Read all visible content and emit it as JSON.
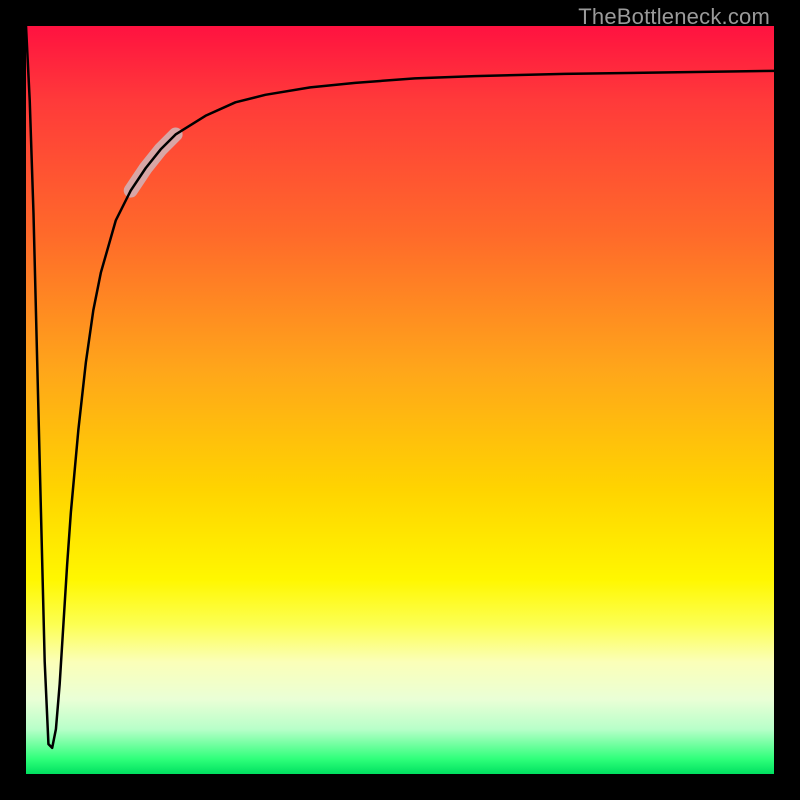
{
  "attribution": "TheBottleneck.com",
  "chart_data": {
    "type": "line",
    "title": "",
    "xlabel": "",
    "ylabel": "",
    "xlim": [
      0,
      100
    ],
    "ylim": [
      0,
      100
    ],
    "grid": false,
    "legend": null,
    "background_gradient_stops": [
      {
        "pos": 0,
        "color": "#ff1240"
      },
      {
        "pos": 10,
        "color": "#ff3a3a"
      },
      {
        "pos": 28,
        "color": "#ff6a2a"
      },
      {
        "pos": 46,
        "color": "#ffa61a"
      },
      {
        "pos": 62,
        "color": "#ffd400"
      },
      {
        "pos": 74,
        "color": "#fff700"
      },
      {
        "pos": 80,
        "color": "#fcff52"
      },
      {
        "pos": 85,
        "color": "#fbffb8"
      },
      {
        "pos": 90,
        "color": "#eaffd6"
      },
      {
        "pos": 94,
        "color": "#b8ffc9"
      },
      {
        "pos": 98,
        "color": "#2fff7a"
      },
      {
        "pos": 100,
        "color": "#00e060"
      }
    ],
    "series": [
      {
        "name": "curve",
        "x": [
          0.0,
          0.5,
          1.0,
          1.5,
          2.0,
          2.5,
          3.0,
          3.5,
          4.0,
          4.5,
          5.0,
          5.5,
          6.0,
          7.0,
          8.0,
          9.0,
          10.0,
          12.0,
          14.0,
          16.0,
          18.0,
          20.0,
          24.0,
          28.0,
          32.0,
          38.0,
          44.0,
          52.0,
          60.0,
          72.0,
          86.0,
          100.0
        ],
        "values": [
          100.0,
          90.0,
          75.0,
          55.0,
          35.0,
          15.0,
          4.0,
          3.5,
          6.0,
          12.0,
          20.0,
          28.0,
          35.0,
          46.0,
          55.0,
          62.0,
          67.0,
          74.0,
          78.0,
          81.0,
          83.5,
          85.5,
          88.0,
          89.8,
          90.8,
          91.8,
          92.4,
          93.0,
          93.3,
          93.6,
          93.8,
          94.0
        ]
      }
    ],
    "highlight_segment": {
      "series": "curve",
      "x_range": [
        14.0,
        20.0
      ],
      "color": "#d8a6a6",
      "width": 14
    }
  }
}
